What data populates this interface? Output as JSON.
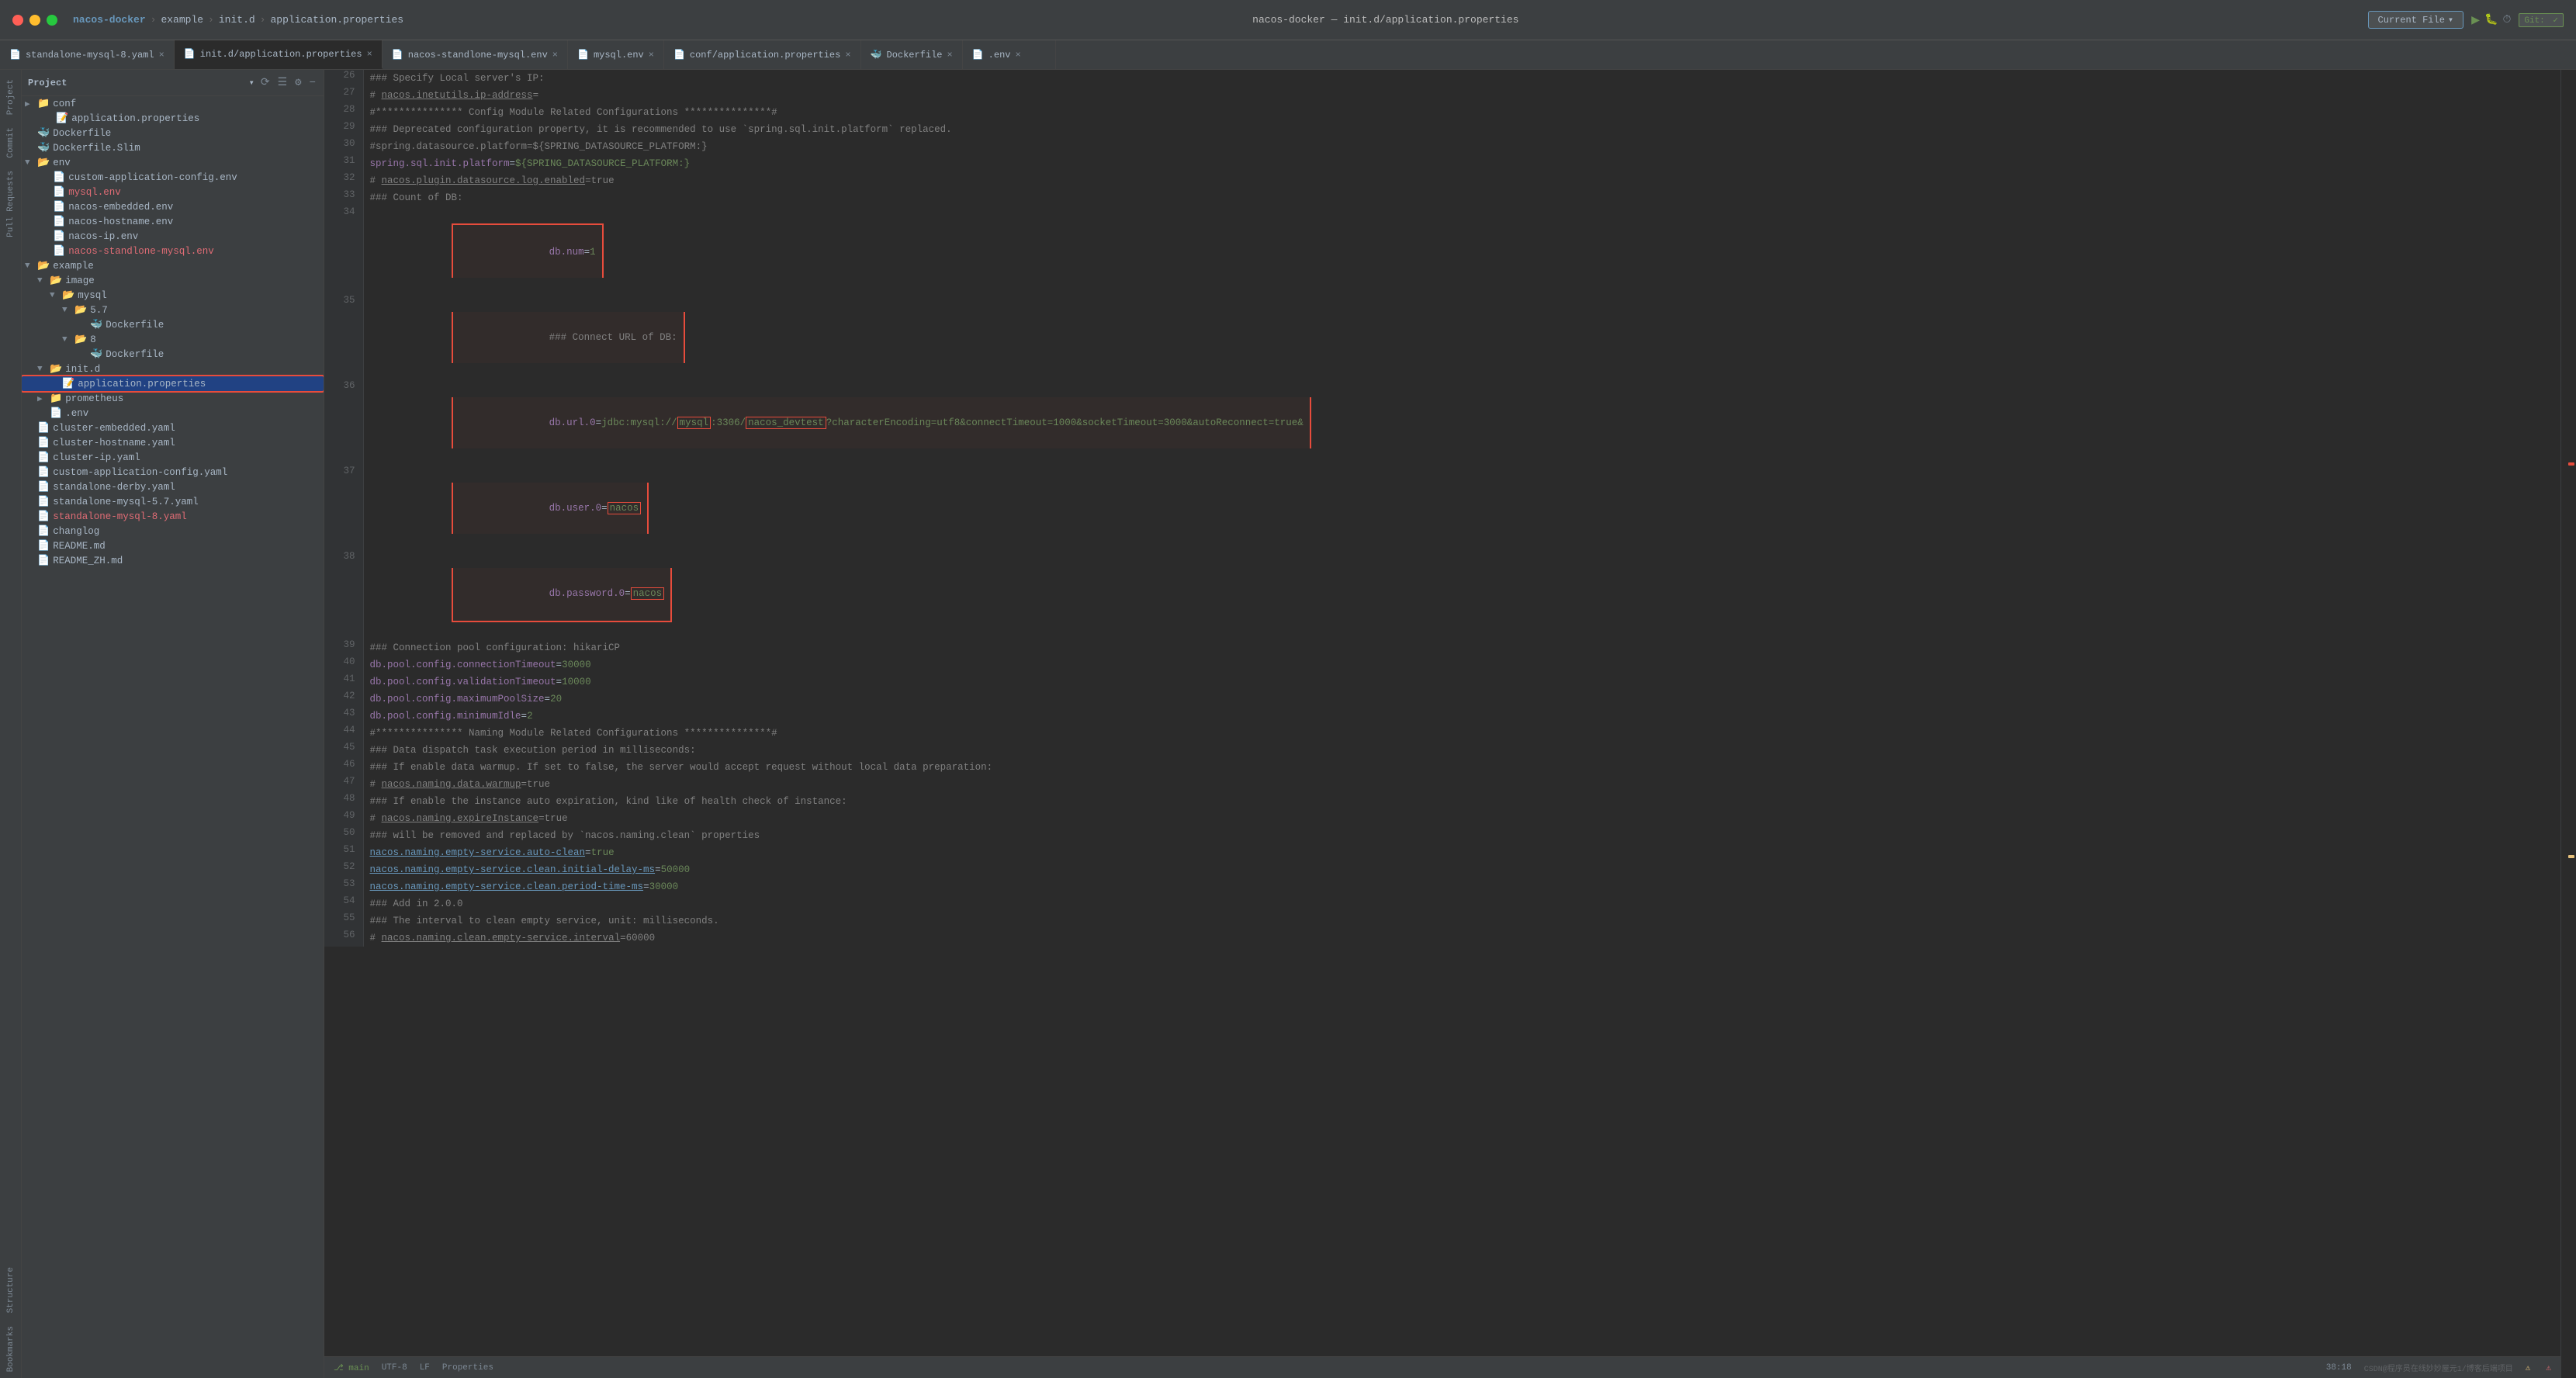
{
  "titlebar": {
    "title": "nacos-docker — init.d/application.properties",
    "breadcrumbs": [
      "nacos-docker",
      "example",
      "init.d",
      "application.properties"
    ]
  },
  "toolbar": {
    "current_file_label": "Current File",
    "git_label": "Git:",
    "dropdown_arrow": "▾"
  },
  "project_panel": {
    "title": "Project",
    "dropdown_arrow": "▾"
  },
  "tabs": [
    {
      "name": "standalone-mysql-8.yaml",
      "active": false,
      "icon": "yaml"
    },
    {
      "name": "init.d/application.properties",
      "active": true,
      "icon": "properties"
    },
    {
      "name": "nacos-standlone-mysql.env",
      "active": false,
      "icon": "env"
    },
    {
      "name": "mysql.env",
      "active": false,
      "icon": "env"
    },
    {
      "name": "conf/application.properties",
      "active": false,
      "icon": "properties"
    },
    {
      "name": "Dockerfile",
      "active": false,
      "icon": "docker"
    },
    {
      "name": ".env",
      "active": false,
      "icon": "env"
    }
  ],
  "file_tree": [
    {
      "indent": 0,
      "type": "folder",
      "name": "conf",
      "expanded": false
    },
    {
      "indent": 1,
      "type": "file",
      "name": "application.properties",
      "icon": "properties"
    },
    {
      "indent": 0,
      "type": "file",
      "name": "Dockerfile",
      "icon": "docker"
    },
    {
      "indent": 0,
      "type": "file",
      "name": "Dockerfile.Slim",
      "icon": "docker"
    },
    {
      "indent": 0,
      "type": "folder",
      "name": "env",
      "expanded": true
    },
    {
      "indent": 1,
      "type": "file",
      "name": "custom-application-config.env",
      "icon": "env"
    },
    {
      "indent": 1,
      "type": "file",
      "name": "mysql.env",
      "icon": "env",
      "color": "red"
    },
    {
      "indent": 1,
      "type": "file",
      "name": "nacos-embedded.env",
      "icon": "env"
    },
    {
      "indent": 1,
      "type": "file",
      "name": "nacos-hostname.env",
      "icon": "env"
    },
    {
      "indent": 1,
      "type": "file",
      "name": "nacos-ip.env",
      "icon": "env"
    },
    {
      "indent": 1,
      "type": "file",
      "name": "nacos-standlone-mysql.env",
      "icon": "env",
      "color": "red"
    },
    {
      "indent": 0,
      "type": "folder",
      "name": "example",
      "expanded": true
    },
    {
      "indent": 1,
      "type": "folder",
      "name": "image",
      "expanded": true
    },
    {
      "indent": 2,
      "type": "folder",
      "name": "mysql",
      "expanded": true
    },
    {
      "indent": 3,
      "type": "folder",
      "name": "5.7",
      "expanded": true
    },
    {
      "indent": 4,
      "type": "file",
      "name": "Dockerfile",
      "icon": "docker"
    },
    {
      "indent": 3,
      "type": "folder",
      "name": "8",
      "expanded": true
    },
    {
      "indent": 4,
      "type": "file",
      "name": "Dockerfile",
      "icon": "docker"
    },
    {
      "indent": 1,
      "type": "folder",
      "name": "init.d",
      "expanded": true
    },
    {
      "indent": 2,
      "type": "file",
      "name": "application.properties",
      "icon": "properties",
      "selected": true,
      "highlighted": true
    },
    {
      "indent": 1,
      "type": "folder",
      "name": "prometheus",
      "expanded": false
    },
    {
      "indent": 1,
      "type": "file",
      "name": ".env",
      "icon": "env"
    },
    {
      "indent": 0,
      "type": "file",
      "name": "cluster-embedded.yaml",
      "icon": "yaml"
    },
    {
      "indent": 0,
      "type": "file",
      "name": "cluster-hostname.yaml",
      "icon": "yaml"
    },
    {
      "indent": 0,
      "type": "file",
      "name": "cluster-ip.yaml",
      "icon": "yaml"
    },
    {
      "indent": 0,
      "type": "file",
      "name": "custom-application-config.yaml",
      "icon": "yaml"
    },
    {
      "indent": 0,
      "type": "file",
      "name": "standalone-derby.yaml",
      "icon": "yaml"
    },
    {
      "indent": 0,
      "type": "file",
      "name": "standalone-mysql-5.7.yaml",
      "icon": "yaml"
    },
    {
      "indent": 0,
      "type": "file",
      "name": "standalone-mysql-8.yaml",
      "icon": "yaml",
      "color": "red"
    },
    {
      "indent": 0,
      "type": "file",
      "name": "changlog",
      "icon": "file"
    },
    {
      "indent": 0,
      "type": "file",
      "name": "README.md",
      "icon": "md"
    },
    {
      "indent": 0,
      "type": "file",
      "name": "README_ZH.md",
      "icon": "md"
    }
  ],
  "code_lines": [
    {
      "num": 26,
      "text": "### Specify Local server's IP:"
    },
    {
      "num": 27,
      "text": "# nacos.inetutils.ip-address="
    },
    {
      "num": 28,
      "text": "#*************** Config Module Related Configurations ***************#"
    },
    {
      "num": 29,
      "text": "### Deprecated configuration property, it is recommended to use `spring.sql.init.platform` replaced."
    },
    {
      "num": 30,
      "text": "#spring.datasource.platform=${SPRING_DATASOURCE_PLATFORM:}"
    },
    {
      "num": 31,
      "text": "spring.sql.init.platform=${SPRING_DATASOURCE_PLATFORM:}"
    },
    {
      "num": 32,
      "text": "# nacos.plugin.datasource.log.enabled=true"
    },
    {
      "num": 33,
      "text": "### Count of DB:"
    },
    {
      "num": 34,
      "text": "db.num=1",
      "box_start": true
    },
    {
      "num": 35,
      "text": "### Connect URL of DB:"
    },
    {
      "num": 36,
      "text": "db.url.0=jdbc:mysql://mysql:3306/nacos_devtest?characterEncoding=utf8&connectTimeout=1000&socketTimeout=3000&autoReconnect=true&"
    },
    {
      "num": 37,
      "text": "db.user.0=nacos"
    },
    {
      "num": 38,
      "text": "db.password.0=nacos",
      "box_end": true
    },
    {
      "num": 39,
      "text": "### Connection pool configuration: hikariCP"
    },
    {
      "num": 40,
      "text": "db.pool.config.connectionTimeout=30000"
    },
    {
      "num": 41,
      "text": "db.pool.config.validationTimeout=10000"
    },
    {
      "num": 42,
      "text": "db.pool.config.maximumPoolSize=20"
    },
    {
      "num": 43,
      "text": "db.pool.config.minimumIdle=2"
    },
    {
      "num": 44,
      "text": "#*************** Naming Module Related Configurations ***************#"
    },
    {
      "num": 45,
      "text": "### Data dispatch task execution period in milliseconds:"
    },
    {
      "num": 46,
      "text": "### If enable data warmup. If set to false, the server would accept request without local data preparation:"
    },
    {
      "num": 47,
      "text": "# nacos.naming.data.warmup=true"
    },
    {
      "num": 48,
      "text": "### If enable the instance auto expiration, kind like of health check of instance:"
    },
    {
      "num": 49,
      "text": "# nacos.naming.expireInstance=true"
    },
    {
      "num": 50,
      "text": "### will be removed and replaced by `nacos.naming.clean` properties"
    },
    {
      "num": 51,
      "text": "nacos.naming.empty-service.auto-clean=true"
    },
    {
      "num": 52,
      "text": "nacos.naming.empty-service.clean.initial-delay-ms=50000"
    },
    {
      "num": 53,
      "text": "nacos.naming.empty-service.clean.period-time-ms=30000"
    },
    {
      "num": 54,
      "text": "### Add in 2.0.0"
    },
    {
      "num": 55,
      "text": "### The interval to clean empty service, unit: milliseconds."
    },
    {
      "num": 56,
      "text": "# nacos.naming.clean.empty-service.interval=60000"
    }
  ],
  "side_tabs": [
    "Project",
    "Commit",
    "Pull Requests",
    "Structure",
    "Bookmarks"
  ],
  "bottom_bar": {
    "encoding": "UTF-8",
    "line_sep": "LF",
    "lang": "Properties",
    "line_col": "38:18",
    "git_branch": "main"
  }
}
